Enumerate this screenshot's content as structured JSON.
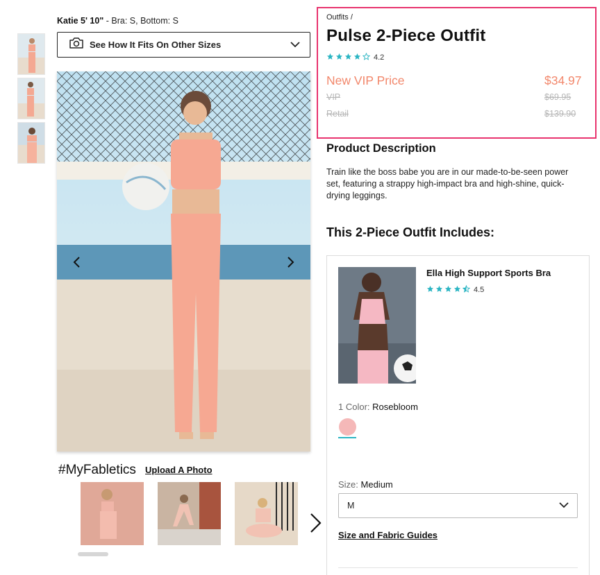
{
  "model_info": {
    "name": "Katie 5' 10\"",
    "sizes": " - Bra: S, Bottom: S"
  },
  "fits_button": {
    "label": "See How It Fits On Other Sizes",
    "icon": "camera-icon"
  },
  "thumbnails": [
    "thumb-1",
    "thumb-2",
    "thumb-3"
  ],
  "myfabletics": {
    "title": "#MyFabletics",
    "upload_label": "Upload A Photo"
  },
  "product": {
    "breadcrumb": "Outfits /",
    "title": "Pulse 2-Piece Outfit",
    "rating": "4.2",
    "rating_stars": 4,
    "vip_label": "New VIP Price",
    "vip_price": "$34.97",
    "old_vip_label": "VIP",
    "old_vip_price": "$69.95",
    "retail_label": "Retail",
    "retail_price": "$139.90"
  },
  "description": {
    "heading": "Product Description",
    "text": "Train like the boss babe you are in our made-to-be-seen power set, featuring a strappy high-impact bra and high-shine, quick-drying leggings."
  },
  "includes": {
    "heading": "This 2-Piece Outfit Includes:",
    "item": {
      "name": "Ella High Support Sports Bra",
      "rating": "4.5",
      "rating_stars": 4.5,
      "color_prefix": "1 Color: ",
      "color_value": "Rosebloom",
      "size_prefix": "Size: ",
      "size_value": "Medium",
      "size_selected": "M",
      "guides_label": "Size and Fabric Guides"
    }
  },
  "colors": {
    "accent_border": "#e8336e",
    "vip_price": "#f2876b",
    "star": "#2bb5c3",
    "swatch": "#f5b8b8"
  }
}
